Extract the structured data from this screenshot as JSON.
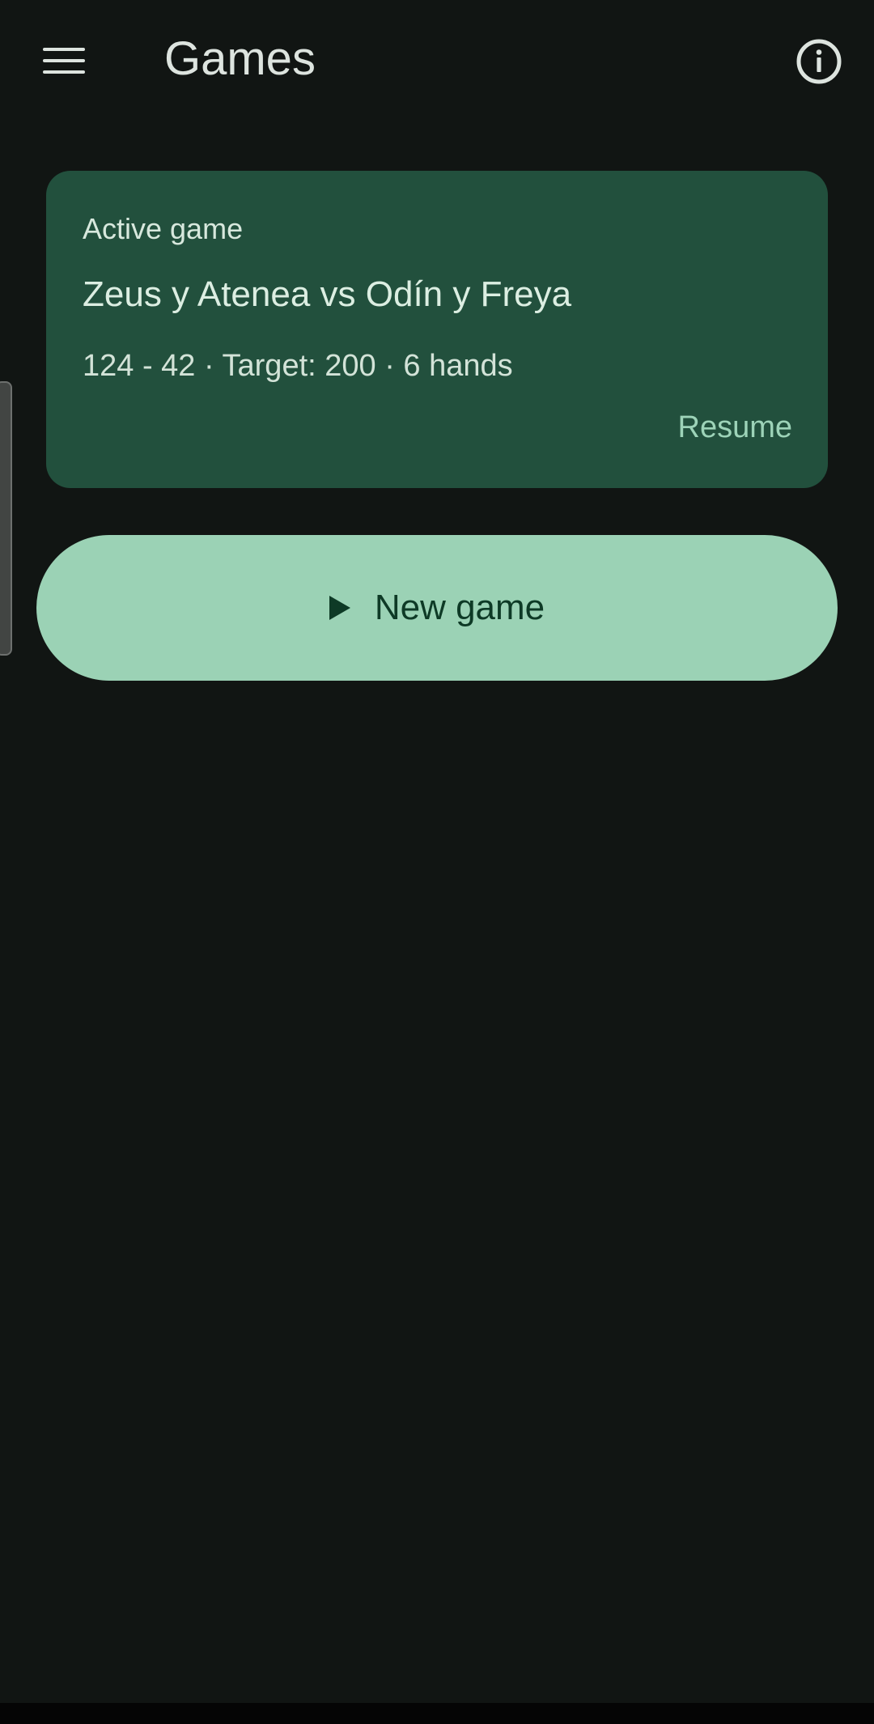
{
  "app_bar": {
    "title": "Games",
    "menu_icon": "menu-icon",
    "info_icon": "info-icon"
  },
  "active_game": {
    "label": "Active game",
    "teams": "Zeus y Atenea vs Odín y Freya",
    "score_line": "124 - 42 · Target: 200 · 6 hands",
    "resume_label": "Resume"
  },
  "new_game": {
    "icon": "play-icon",
    "label": "New game"
  },
  "colors": {
    "background": "#111513",
    "card": "#22503d",
    "accent": "#9bd2b5",
    "accent_text": "#0e3a26",
    "resume_text": "#9dd3b8"
  }
}
